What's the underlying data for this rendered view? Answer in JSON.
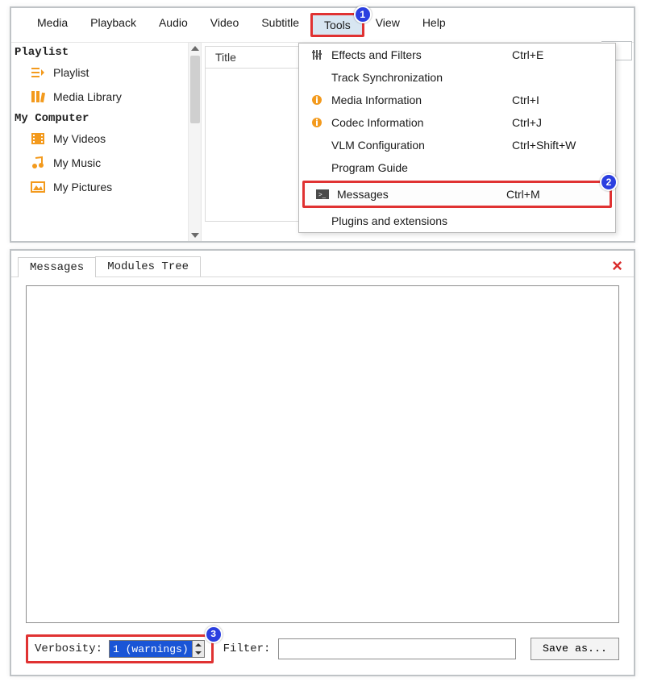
{
  "menubar": {
    "media": "Media",
    "playback": "Playback",
    "audio": "Audio",
    "video": "Video",
    "subtitle": "Subtitle",
    "tools": "Tools",
    "view": "View",
    "help": "Help"
  },
  "sidebar": {
    "section_playlist": "Playlist",
    "items_playlist": [
      {
        "label": "Playlist"
      },
      {
        "label": "Media Library"
      }
    ],
    "section_mycomputer": "My Computer",
    "items_mycomputer": [
      {
        "label": "My Videos"
      },
      {
        "label": "My Music"
      },
      {
        "label": "My Pictures"
      }
    ]
  },
  "list": {
    "header": "Title"
  },
  "tools_menu": {
    "effects": {
      "label": "Effects and Filters",
      "shortcut": "Ctrl+E"
    },
    "tracksync": {
      "label": "Track Synchronization",
      "shortcut": ""
    },
    "mediainfo": {
      "label": "Media Information",
      "shortcut": "Ctrl+I"
    },
    "codecinfo": {
      "label": "Codec Information",
      "shortcut": "Ctrl+J"
    },
    "vlm": {
      "label": "VLM Configuration",
      "shortcut": "Ctrl+Shift+W"
    },
    "guide": {
      "label": "Program Guide",
      "shortcut": ""
    },
    "messages": {
      "label": "Messages",
      "shortcut": "Ctrl+M"
    },
    "plugins": {
      "label": "Plugins and extensions",
      "shortcut": ""
    }
  },
  "steps": {
    "one": "1",
    "two": "2",
    "three": "3"
  },
  "messages_window": {
    "tab_messages": "Messages",
    "tab_modules": "Modules Tree",
    "close": "×",
    "verbosity_label": "Verbosity:",
    "verbosity_value": "1 (warnings)",
    "filter_label": "Filter:",
    "filter_value": "",
    "save_button": "Save as..."
  }
}
